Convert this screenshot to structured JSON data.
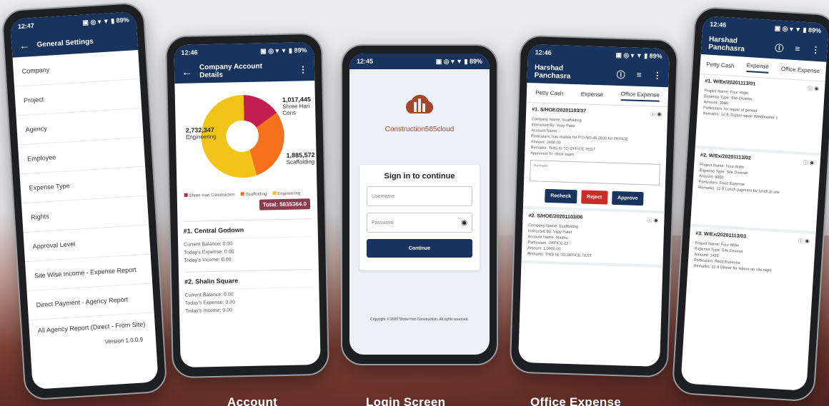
{
  "phone1": {
    "time": "12:47",
    "status_icons": "▣ ◎ ▾ ▼ ▮ 89%",
    "title": "General Settings",
    "menu": [
      "Company",
      "Project",
      "Agency",
      "Employee",
      "Expense Type",
      "Rights",
      "Approval Level",
      "Site Wise Income - Expense Report",
      "Direct Payment - Agency Report",
      "All Agency Report (Direct - From Site)"
    ],
    "version": "Version 1.0.0.9"
  },
  "phone2": {
    "time": "12:46",
    "status_icons": "▣ ◎ ▾ ▼ ▮ 89%",
    "title": "Company Account Details",
    "labels": {
      "a_value": "1,017,445",
      "a_name": "Shree Hari Cons",
      "b_value": "2,732,347",
      "b_name": "Engineering",
      "c_value": "1,885,572",
      "c_name": "Scaffolding"
    },
    "legend": [
      "Shree Hari Construction",
      "Scaffolding",
      "Engineering"
    ],
    "total": "Total: 5635364.0",
    "branches": [
      {
        "title": "#1.  Central Godown",
        "lines": [
          "Current Balance: 0.00",
          "Today's Expense: 0.00",
          "Today's Income: 0.00"
        ]
      },
      {
        "title": "#2.  Shalin Square",
        "lines": [
          "Current Balance: 0.00",
          "Today's Expense: 0.00",
          "Today's Income: 0.00"
        ]
      }
    ]
  },
  "phone3": {
    "time": "12:45",
    "status_icons": "▣ ◎ ▾ ▼ ▮ 89%",
    "logo_text": "Construction565cloud",
    "heading": "Sign in to continue",
    "username_placeholder": "Username",
    "password_placeholder": "Password",
    "button": "Continue",
    "copyright": "Copyright © 2020 Shree Hari Construction. All rights reserved."
  },
  "phone4": {
    "time": "12:46",
    "status_icons": "▣ ◎ ▾ ▼ ▮ 89%",
    "title": "Harshad Panchasra",
    "tabs": [
      "Petty Cash",
      "Expense",
      "Office Expense"
    ],
    "card1": {
      "title": "#1.  S/HOE/20201103/37",
      "lines": [
        "Company Name: Scaffolding",
        "Instructed By: Vijay Patel",
        "Account Name: -",
        "Particulars: hari marble for P.O.NO.45-2020 for OFFICE",
        "Amount: 2400.00",
        "Remarks: THIS IS TO OFFICE TEST",
        "Approved To: stock team"
      ],
      "remarks_placeholder": "Remarks"
    },
    "buttons": [
      "Recheck",
      "Reject",
      "Approve"
    ],
    "card2": {
      "title": "#2.  S/HOE/20201103/06",
      "lines": [
        "Company Name: Scaffolding",
        "Instructed By: Vijay Patel",
        "Account Name: Madhu",
        "Particulars: OFFICE 22",
        "Amount: 1,0000.00",
        "Remarks: THIS IS TO OFFICE TEST"
      ]
    }
  },
  "phone5": {
    "time": "12:46",
    "status_icons": "▣ ◎ ▾ ▼ ▮ 89%",
    "title": "Harshad Panchasra",
    "tabs": [
      "Petty Cash",
      "Expense",
      "Office Expense"
    ],
    "cards": [
      {
        "title": "#1.  W/Ex/20201113/01",
        "lines": [
          "Project Name: Four Wdin",
          "Expense Type: Site Diverse",
          "Amount: 3000",
          "Particulars: for repair of genset",
          "Remarks: 12.8, Digital repair Weldmaster 1"
        ]
      },
      {
        "title": "#2.  W/Ex/20201113/02",
        "lines": [
          "Project Name: Four Wdin",
          "Expense Type: Site Diverse",
          "Amount: 5000",
          "Particulars: Food Expense",
          "Remarks: 12.8 Lunch payment for lunch at site"
        ]
      },
      {
        "title": "#3.  W/Ex/20201113/03",
        "lines": [
          "Project Name: Four Wdin",
          "Expense Type: Site Diverse",
          "Amount: 1425",
          "Particulars: Food Expense",
          "Remarks: 12.8 Dinner for labour on site night"
        ]
      }
    ]
  },
  "captions": [
    "Account",
    "Login Screen",
    "Office Expense"
  ]
}
